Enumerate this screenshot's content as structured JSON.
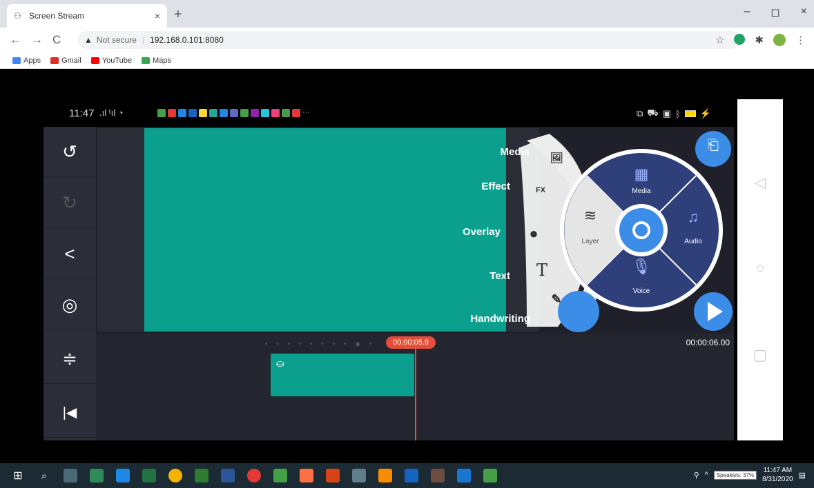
{
  "browser": {
    "tab_title": "Screen Stream",
    "tab_close": "×",
    "new_tab": "+",
    "window_controls": [
      "–",
      "◻",
      "×"
    ],
    "nav": [
      "←",
      "→",
      "C"
    ],
    "security_label": "Not secure",
    "url": "192.168.0.101:8080",
    "bookmarks": [
      {
        "label": "Apps",
        "color": "#4285f4"
      },
      {
        "label": "Gmail",
        "color": "#d93025"
      },
      {
        "label": "YouTube",
        "color": "#ff0000"
      },
      {
        "label": "Maps",
        "color": "#34a853"
      }
    ]
  },
  "phone_status": {
    "time": "11:47",
    "signal": ".ıl ᵗıl ◔",
    "more": "···"
  },
  "left_panel": {
    "buttons": [
      {
        "icon": "↺",
        "name": "undo-icon"
      },
      {
        "icon": "↻",
        "name": "redo-icon"
      },
      {
        "icon": "<",
        "name": "share-icon"
      },
      {
        "icon": "◎",
        "name": "settings-icon"
      },
      {
        "icon": "≑",
        "name": "timeline-adjust-icon"
      },
      {
        "icon": "|◀",
        "name": "skip-to-start-icon"
      }
    ]
  },
  "timeline": {
    "playhead_time": "00:00:05.9",
    "total_time": "00:00:06.00",
    "ruler": "• • • • • • • • ◆ •"
  },
  "fan_menu": {
    "items": [
      {
        "label": "Media",
        "icon": "🖼"
      },
      {
        "label": "Effect",
        "icon": "FX"
      },
      {
        "label": "Overlay",
        "icon": "●"
      },
      {
        "label": "Text",
        "icon": "T"
      },
      {
        "label": "Handwriting",
        "icon": "✎"
      }
    ]
  },
  "wheel": {
    "media": "Media",
    "audio": "Audio",
    "voice": "Voice",
    "layer": "Layer"
  },
  "taskbar": {
    "time": "11:47 AM",
    "date": "8/31/2020",
    "speakers": "Speakers: 37%"
  },
  "colors": {
    "accent": "#3c8de8",
    "preview": "#0ba08e",
    "playhead": "#e74c3c"
  }
}
